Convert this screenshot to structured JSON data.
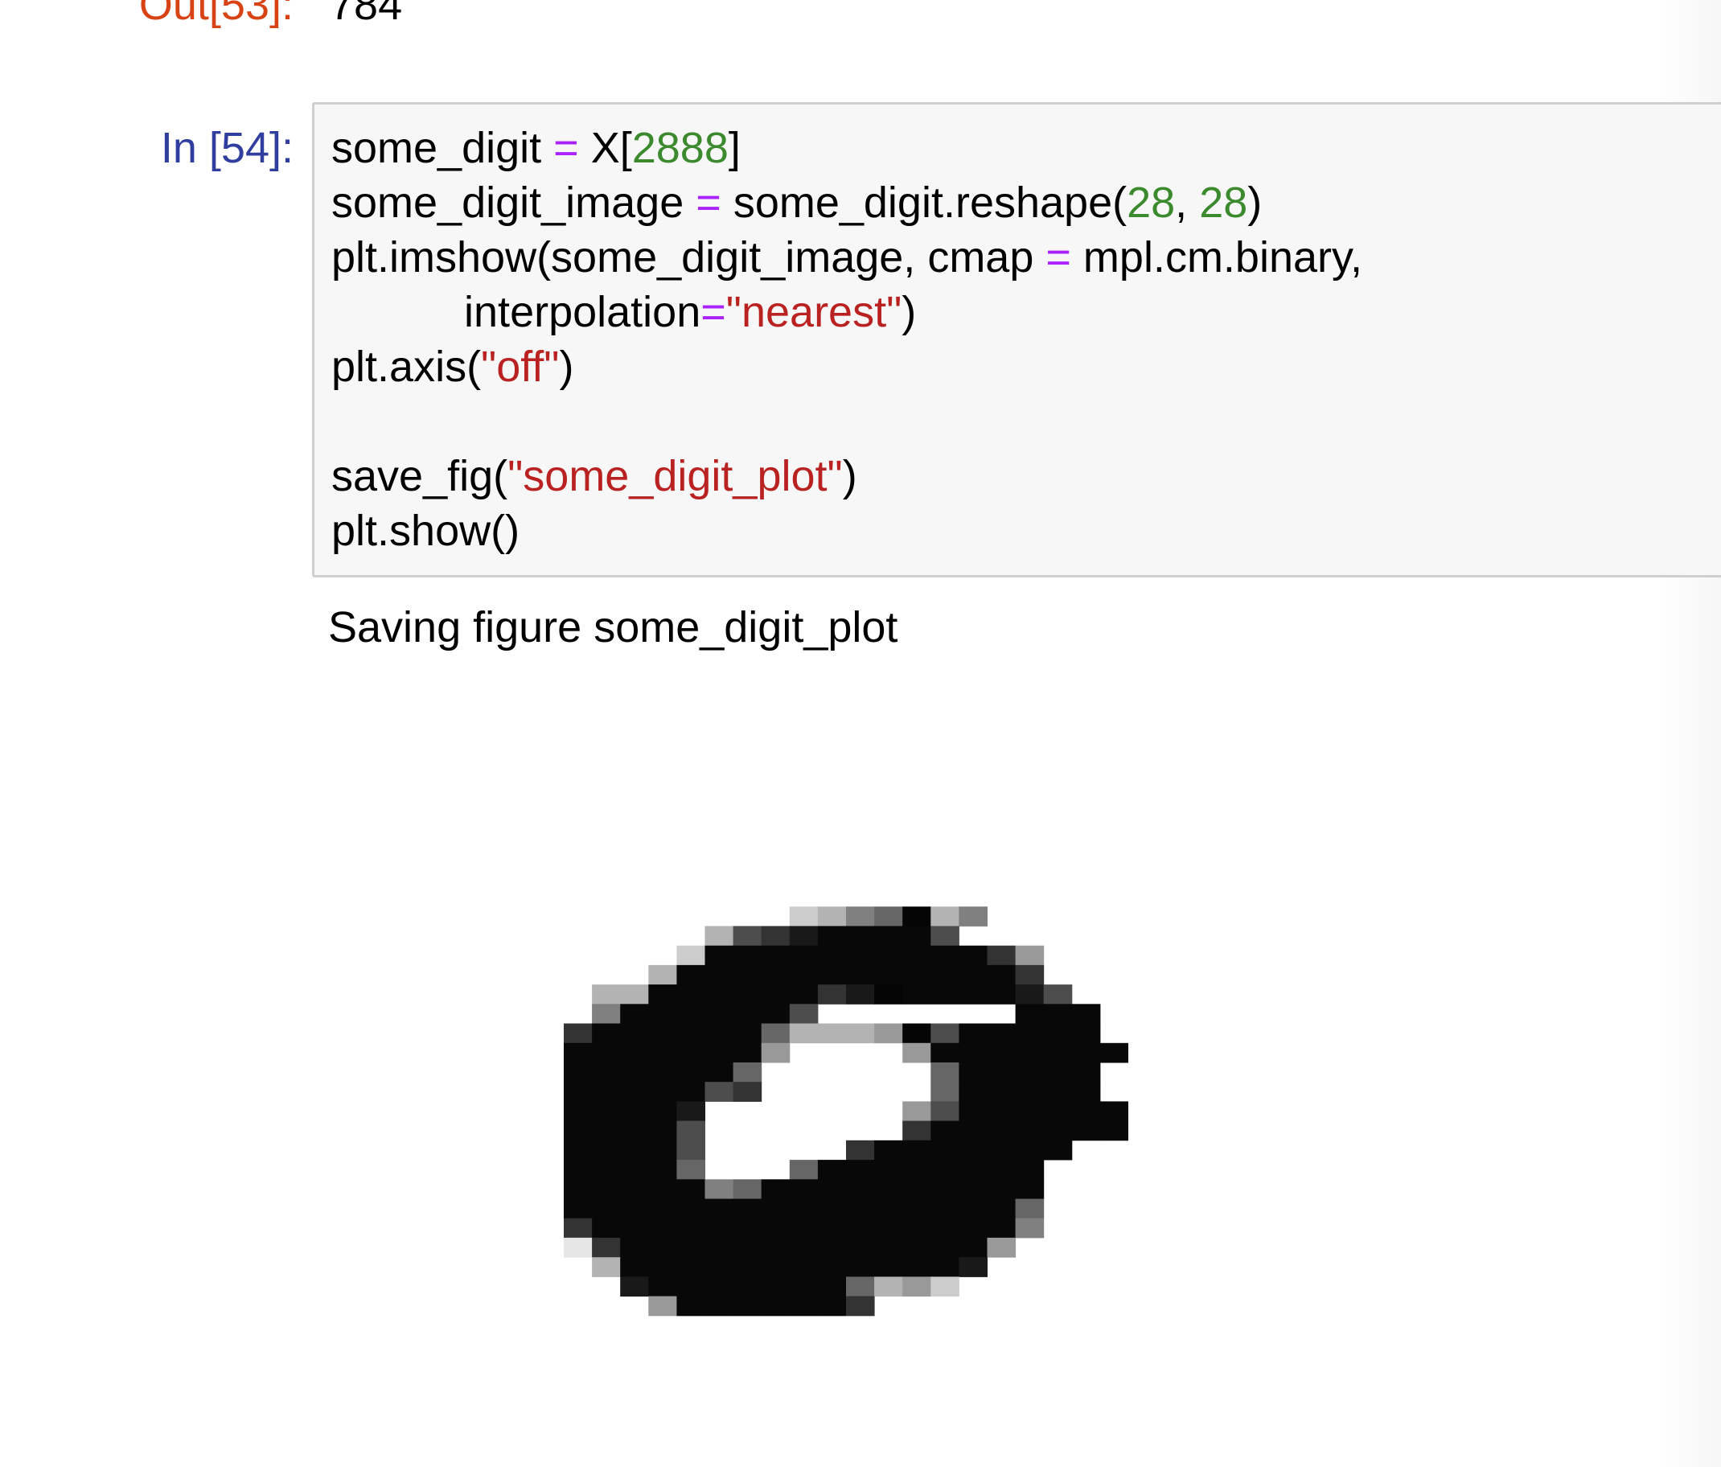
{
  "cells": {
    "prev_output": {
      "prompt": "Out[53]:",
      "value": "784"
    },
    "input": {
      "prompt": "In [54]:",
      "lines": [
        [
          {
            "t": "txt",
            "v": "some_digit "
          },
          {
            "t": "op",
            "v": "="
          },
          {
            "t": "txt",
            "v": " X["
          },
          {
            "t": "num",
            "v": "2888"
          },
          {
            "t": "txt",
            "v": "]"
          }
        ],
        [
          {
            "t": "txt",
            "v": "some_digit_image "
          },
          {
            "t": "op",
            "v": "="
          },
          {
            "t": "txt",
            "v": " some_digit.reshape("
          },
          {
            "t": "num",
            "v": "28"
          },
          {
            "t": "txt",
            "v": ", "
          },
          {
            "t": "num",
            "v": "28"
          },
          {
            "t": "txt",
            "v": ")"
          }
        ],
        [
          {
            "t": "txt",
            "v": "plt.imshow(some_digit_image, cmap "
          },
          {
            "t": "op",
            "v": "="
          },
          {
            "t": "txt",
            "v": " mpl.cm.binary,"
          }
        ],
        [
          {
            "t": "txt",
            "v": "           interpolation"
          },
          {
            "t": "op",
            "v": "="
          },
          {
            "t": "str",
            "v": "\"nearest\""
          },
          {
            "t": "txt",
            "v": ")"
          }
        ],
        [
          {
            "t": "txt",
            "v": "plt.axis("
          },
          {
            "t": "str",
            "v": "\"off\""
          },
          {
            "t": "txt",
            "v": ")"
          }
        ],
        [],
        [
          {
            "t": "txt",
            "v": "save_fig("
          },
          {
            "t": "str",
            "v": "\"some_digit_plot\""
          },
          {
            "t": "txt",
            "v": ")"
          }
        ],
        [
          {
            "t": "txt",
            "v": "plt.show()"
          }
        ]
      ]
    },
    "stream_output": "Saving figure some_digit_plot"
  },
  "colors": {
    "prompt_in": "#303f9f",
    "prompt_out": "#d84315",
    "operator": "#aa22ff",
    "number": "#3b8a2e",
    "string": "#ba2121",
    "input_bg": "#f7f7f7",
    "input_border": "#cfcfcf"
  },
  "figure": {
    "type": "heatmap",
    "colormap": "binary",
    "axis": "off",
    "rows": [
      "....................",
      "........2356-35.....",
      ".....3789++++7......",
      "....2++++++++++84...",
      "...3++++++++++++8...",
      ".33++++++89-++++97..",
      ".5++++++7.......+++.",
      "8++++++63334-7+++++.",
      "+++++++4....4+++++++",
      "++++++6......6+++++.",
      "+++++78......6+++++.",
      "++++9.......47++++++",
      "++++7.......8+++++++",
      "++++7.....8+++++++..",
      "++++6...6++++++++...",
      "+++++56++++++++++...",
      "++++++++++++++++6...",
      "8+++++++++++++++5...",
      "18+++++++++++++4....",
      ".3++++++++++++9.....",
      "..9+++++++6342......",
      "...4++++++8.........",
      "...................."
    ]
  }
}
